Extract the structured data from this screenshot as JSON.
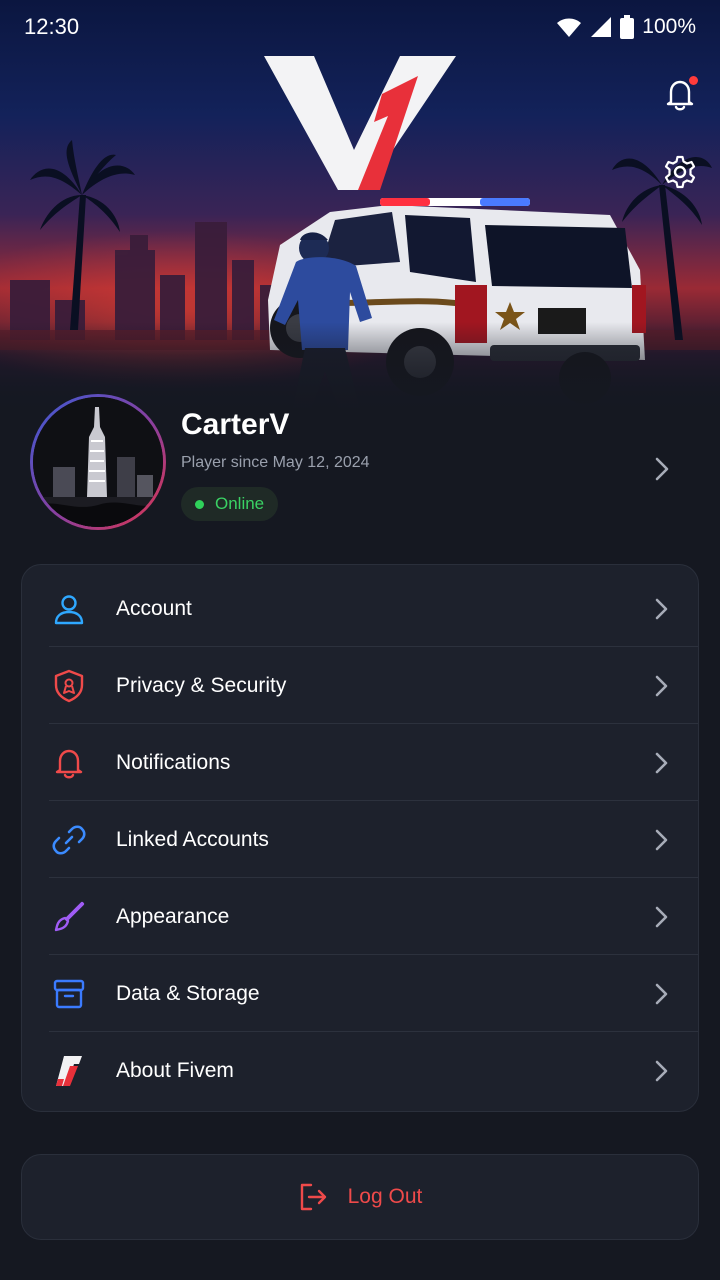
{
  "status_bar": {
    "time": "12:30",
    "battery": "100%",
    "icons": [
      "wifi-icon",
      "signal-icon",
      "battery-icon"
    ]
  },
  "header": {
    "logo": "V1",
    "actions": [
      {
        "name": "notifications",
        "icon": "bell-icon",
        "has_unread": true
      },
      {
        "name": "settings",
        "icon": "gear-icon"
      }
    ]
  },
  "profile": {
    "name": "CarterV",
    "since": "Player since May 12, 2024",
    "status": "Online",
    "status_color": "#2fd25a"
  },
  "menu": {
    "items": [
      {
        "label": "Account",
        "icon": "user-icon",
        "color": "#2fa8ff"
      },
      {
        "label": "Privacy & Security",
        "icon": "shield-icon",
        "color": "#ef4a4a"
      },
      {
        "label": "Notifications",
        "icon": "bell-icon",
        "color": "#ef4a4a"
      },
      {
        "label": "Linked Accounts",
        "icon": "link-icon",
        "color": "#3b8bff"
      },
      {
        "label": "Appearance",
        "icon": "brush-icon",
        "color": "#a05cf5"
      },
      {
        "label": "Data & Storage",
        "icon": "archive-icon",
        "color": "#3b7bff"
      },
      {
        "label": "About Fivem",
        "icon": "fivem-logo-icon",
        "color": "#ef4a4a"
      }
    ]
  },
  "logout": {
    "label": "Log Out",
    "icon": "logout-icon",
    "color": "#ef4a4a"
  },
  "colors": {
    "background": "#151821",
    "card": "#1d212c",
    "accent_red": "#ef4a4a"
  }
}
